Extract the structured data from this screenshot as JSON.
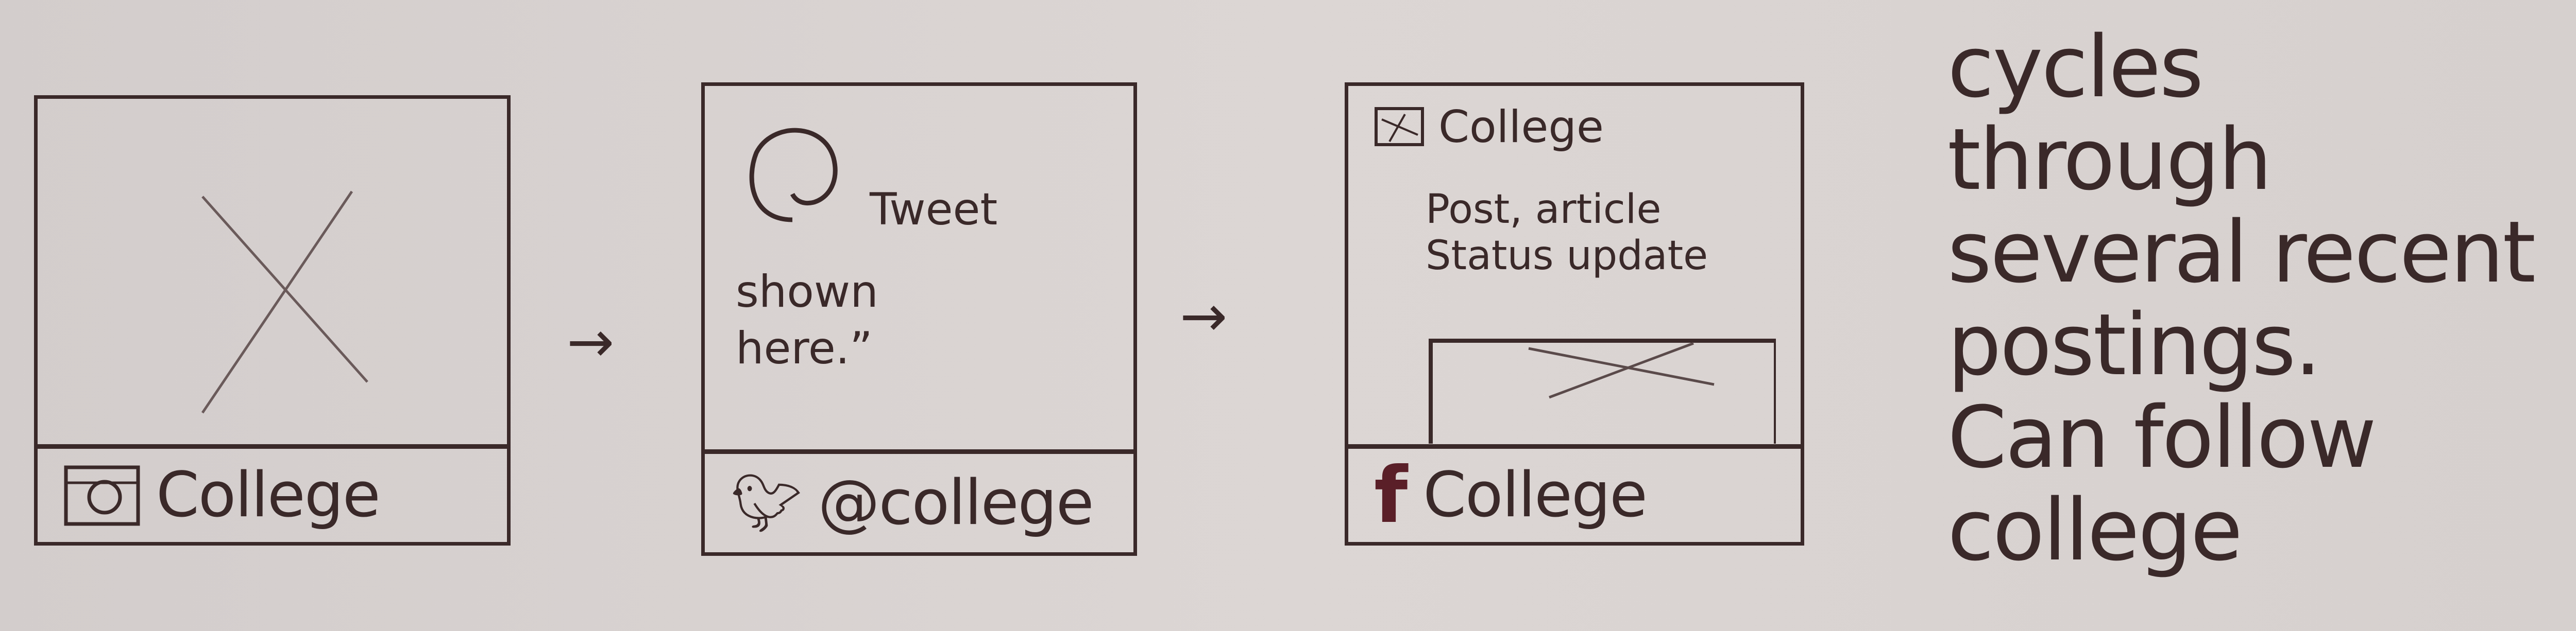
{
  "panels": [
    {
      "type": "image",
      "footer": {
        "icon": "instagram-icon",
        "label": "College"
      }
    },
    {
      "type": "tweet",
      "body": [
        "Tweet",
        "shown",
        "here.”"
      ],
      "footer": {
        "icon": "twitter-bird-icon",
        "label": "@college"
      }
    },
    {
      "type": "facebook-post",
      "header": {
        "label": "College"
      },
      "body": [
        "Post, article",
        "Status update"
      ],
      "footer": {
        "icon": "facebook-icon",
        "label": "College"
      }
    }
  ],
  "arrows": [
    "→",
    "→"
  ],
  "notes": [
    "cycles",
    "through",
    "several recent",
    "postings.",
    "Can follow",
    "college"
  ],
  "colors": {
    "ink": "#3a2929",
    "paper": "#d8d2d0",
    "facebook_ink": "#5a1f28"
  }
}
